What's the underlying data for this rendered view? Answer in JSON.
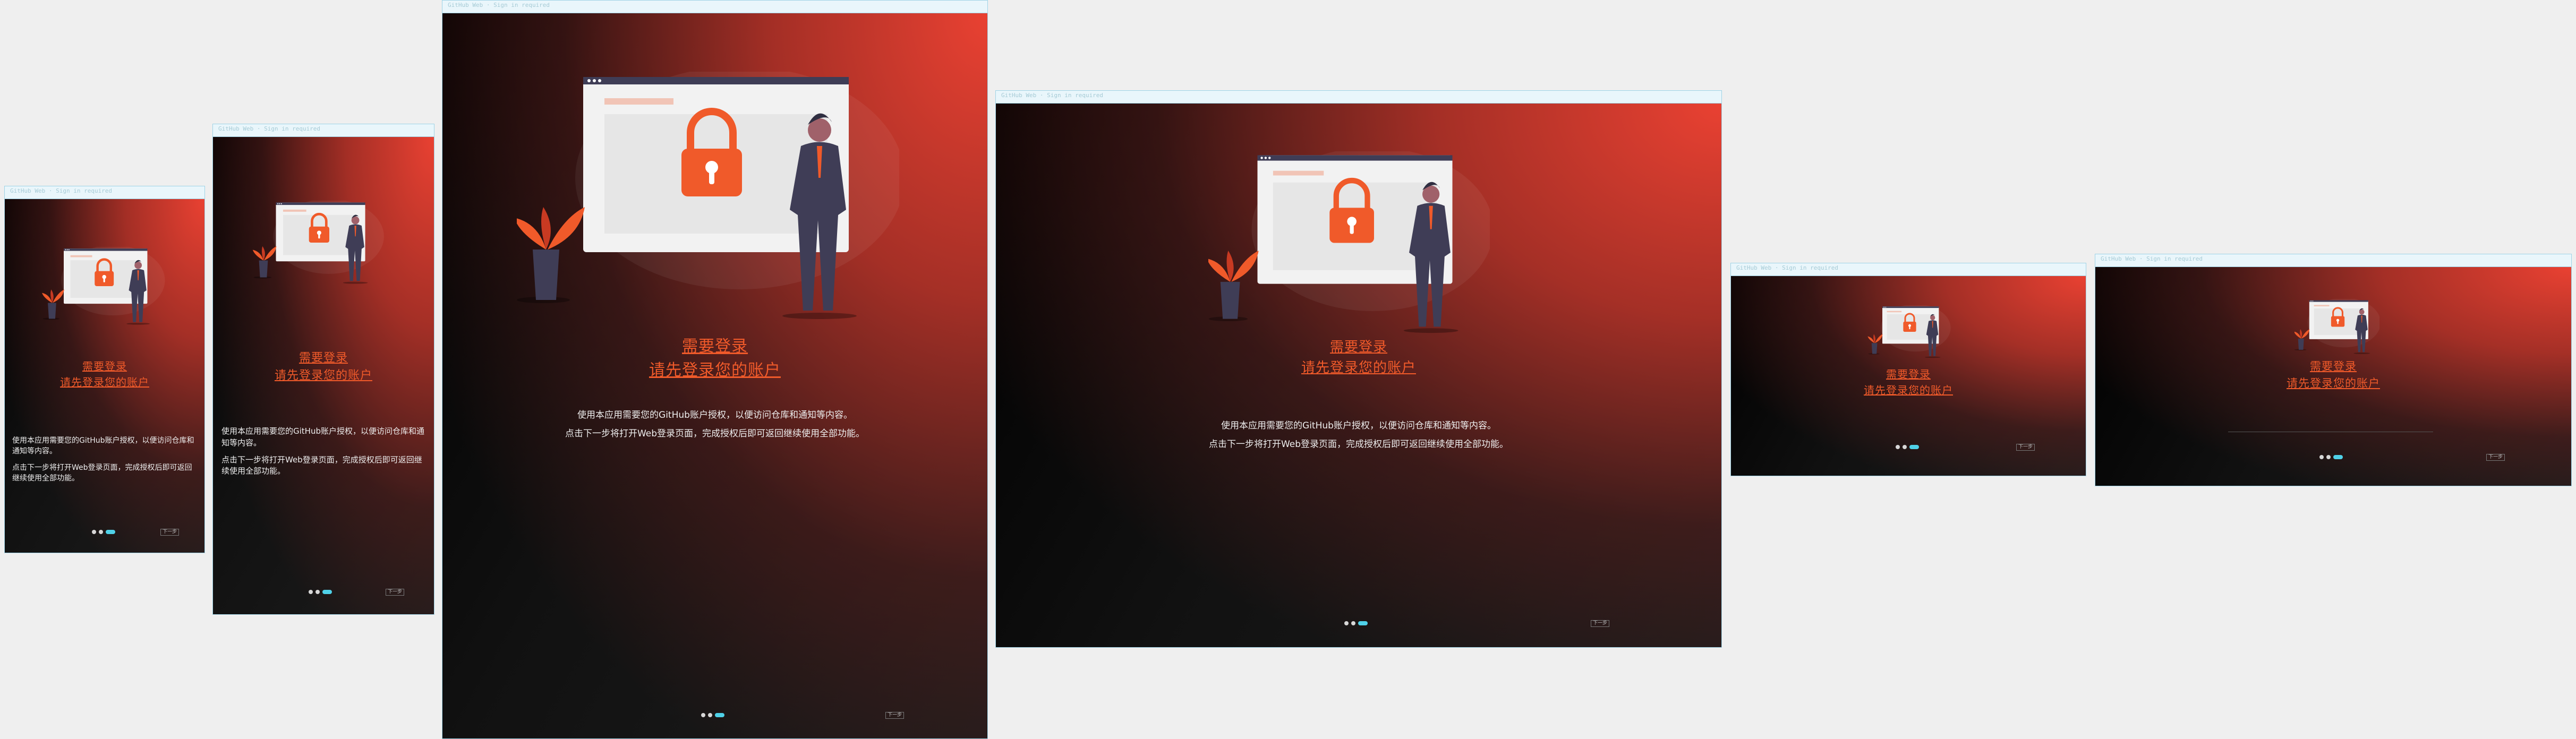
{
  "window": {
    "title": "GitHub Web  ·  Sign in required"
  },
  "onboarding": {
    "heading_line1": "需要登录",
    "heading_line2": "请先登录您的账户",
    "paragraph_1": "使用本应用需要您的GitHub账户授权，以便访问仓库和通知等内容。",
    "paragraph_2": "点击下一步将打开Web登录页面，完成授权后即可返回继续使用全部功能。",
    "next_label": "下一步",
    "pages_total": 3,
    "pages_current": 3
  },
  "colors": {
    "accent_orange": "#f05a2a",
    "gradient_red": "#e94132",
    "dot_active": "#4fd1e8",
    "suit": "#3f3d56"
  },
  "icons": [
    "lock-icon",
    "plant-illustration",
    "person-illustration"
  ]
}
